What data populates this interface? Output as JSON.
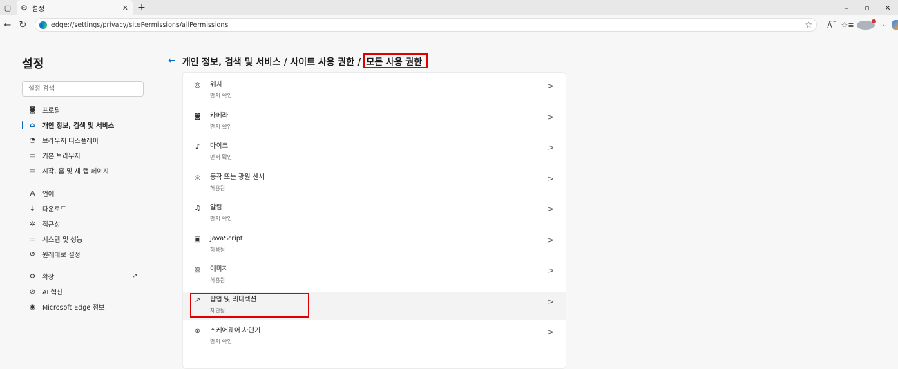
{
  "browser": {
    "tab_title": "설정",
    "url": "edge://settings/privacy/sitePermissions/allPermissions"
  },
  "sidebar": {
    "title": "설정",
    "search_placeholder": "설정 검색",
    "items": [
      {
        "label": "프로필",
        "icon": "profile-icon"
      },
      {
        "label": "개인 정보, 검색 및 서비스",
        "icon": "lock-icon",
        "active": true
      },
      {
        "label": "브라우저 디스플레이",
        "icon": "palette-icon"
      },
      {
        "label": "기본 브라우저",
        "icon": "browser-icon"
      },
      {
        "label": "시작, 홈 및 새 탭 페이지",
        "icon": "home-icon"
      },
      {
        "label": "언어",
        "icon": "language-icon"
      },
      {
        "label": "다운로드",
        "icon": "download-icon"
      },
      {
        "label": "접근성",
        "icon": "accessibility-icon"
      },
      {
        "label": "시스템 및 성능",
        "icon": "system-icon"
      },
      {
        "label": "원래대로 설정",
        "icon": "reset-icon"
      },
      {
        "label": "확장",
        "icon": "extensions-icon"
      },
      {
        "label": "AI 혁신",
        "icon": "ai-icon"
      },
      {
        "label": "Microsoft Edge 정보",
        "icon": "edge-logo-icon"
      }
    ]
  },
  "breadcrumb": {
    "path": "개인 정보, 검색 및 서비스 / 사이트 사용 권한 /",
    "current": "모든 사용 권한"
  },
  "permissions": [
    {
      "name": "위치",
      "status": "먼저 확인",
      "icon": "location-icon"
    },
    {
      "name": "카메라",
      "status": "먼저 확인",
      "icon": "camera-icon"
    },
    {
      "name": "마이크",
      "status": "먼저 확인",
      "icon": "microphone-icon"
    },
    {
      "name": "동작 또는 광원 센서",
      "status": "허용됨",
      "icon": "sensor-icon"
    },
    {
      "name": "알림",
      "status": "먼저 확인",
      "icon": "bell-icon"
    },
    {
      "name": "JavaScript",
      "status": "허용됨",
      "icon": "javascript-icon"
    },
    {
      "name": "이미지",
      "status": "허용됨",
      "icon": "image-icon"
    },
    {
      "name": "팝업 및 리디렉션",
      "status": "차단됨",
      "icon": "popup-icon"
    },
    {
      "name": "스케어웨어 차단기",
      "status": "먼저 확인",
      "icon": "shield-icon"
    }
  ]
}
